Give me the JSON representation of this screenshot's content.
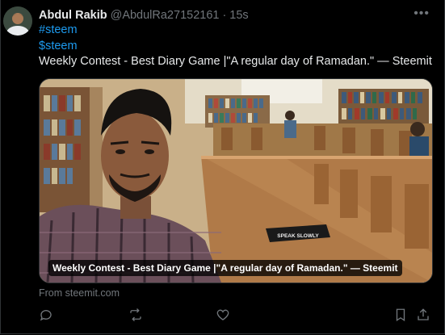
{
  "tweet": {
    "author_name": "Abdul Rakib",
    "author_handle": "@AbdulRa27152161",
    "separator": "·",
    "time": "15s",
    "more_label": "•••",
    "hashtags": [
      "#steem",
      "$steem"
    ],
    "text": "Weekly Contest - Best Diary Game |\"A regular day of Ramadan.\" — Steemit",
    "card": {
      "caption": "Weekly Contest - Best Diary Game |\"A regular day of Ramadan.\" — Steemit",
      "sign_text": "SPEAK SLOWLY"
    },
    "source": "From steemit.com"
  },
  "actions": [
    "reply-icon",
    "retweet-icon",
    "like-icon",
    "bookmark-icon",
    "share-icon"
  ]
}
